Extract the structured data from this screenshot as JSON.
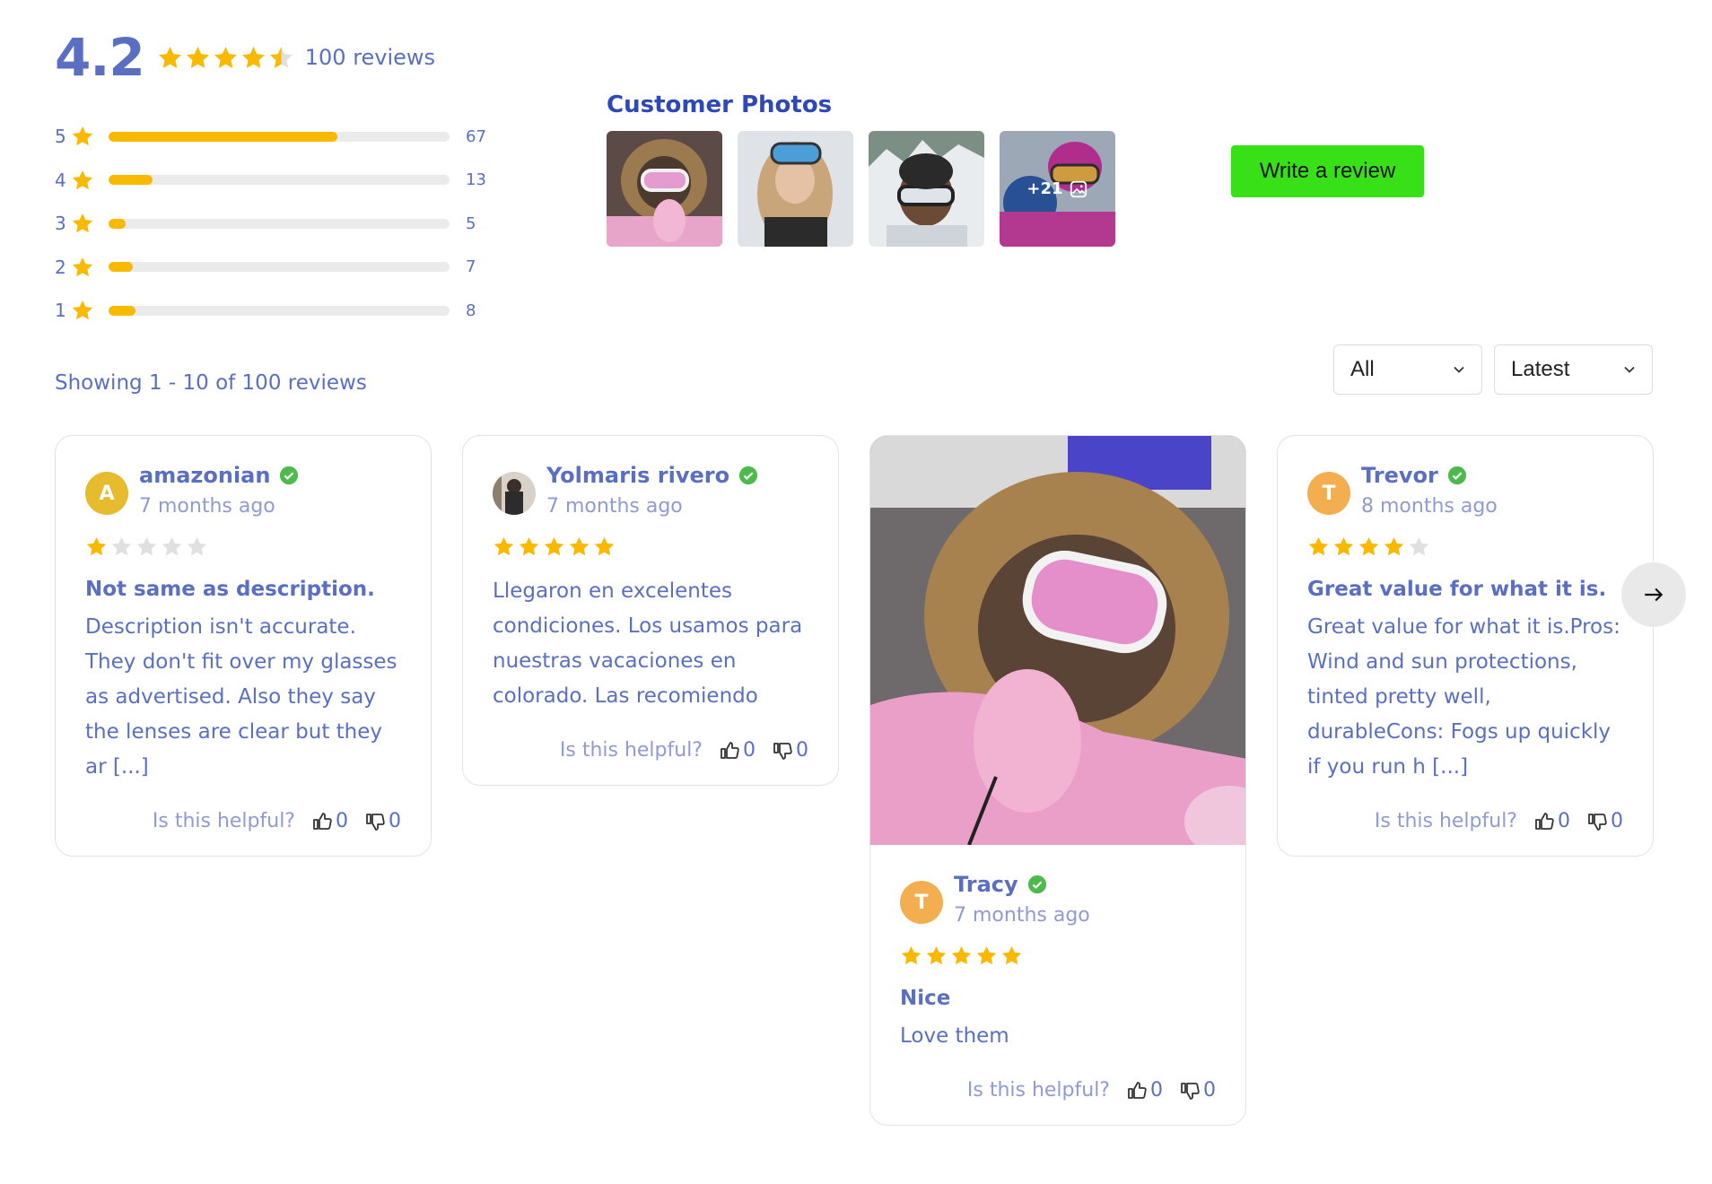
{
  "summary": {
    "average": "4.2",
    "rating": 4.2,
    "total_label": "100 reviews"
  },
  "colors": {
    "star": "#f9b900",
    "star_empty": "#e0e0e0",
    "accent": "#5a6fc2",
    "button_green": "#38e017",
    "verified": "#4cbb4c"
  },
  "breakdown": [
    {
      "stars": "5",
      "count": "67",
      "fraction": 0.67
    },
    {
      "stars": "4",
      "count": "13",
      "fraction": 0.13
    },
    {
      "stars": "3",
      "count": "5",
      "fraction": 0.05
    },
    {
      "stars": "2",
      "count": "7",
      "fraction": 0.07
    },
    {
      "stars": "1",
      "count": "8",
      "fraction": 0.08
    }
  ],
  "photos": {
    "title": "Customer Photos",
    "more_label": "+21"
  },
  "write_review": {
    "label": "Write a review"
  },
  "showing": "Showing 1 - 10 of 100 reviews",
  "filters": {
    "filter_value": "All",
    "sort_value": "Latest"
  },
  "helpful_label": "Is this helpful?",
  "reviews": [
    {
      "initial": "A",
      "name": "amazonian",
      "date": "7 months ago",
      "rating": 1,
      "title": "Not same as description.",
      "text": "Description isn't accurate. They don't fit over my glasses as advertised. Also they say the lenses are clear but they ar [...]",
      "up": "0",
      "down": "0",
      "avatar_color": "#e6bb2e"
    },
    {
      "initial": "",
      "name": "Yolmaris rivero",
      "date": "7 months ago",
      "rating": 5,
      "title": "",
      "text": "Llegaron en excelentes condiciones. Los usamos para nuestras vacaciones en colorado. Las recomiendo",
      "up": "0",
      "down": "0",
      "avatar_color": "#8a8a8a"
    },
    {
      "initial": "T",
      "name": "Tracy",
      "date": "7 months ago",
      "rating": 5,
      "title": "Nice",
      "text": "Love them",
      "up": "0",
      "down": "0",
      "avatar_color": "#f2ae4f"
    },
    {
      "initial": "T",
      "name": "Trevor",
      "date": "8 months ago",
      "rating": 4,
      "title": "Great value for what it is.",
      "text": "Great value for what it is.Pros: Wind and sun protections, tinted pretty well, durableCons: Fogs up quickly if you run h [...]",
      "up": "0",
      "down": "0",
      "avatar_color": "#f2ae4f"
    }
  ]
}
